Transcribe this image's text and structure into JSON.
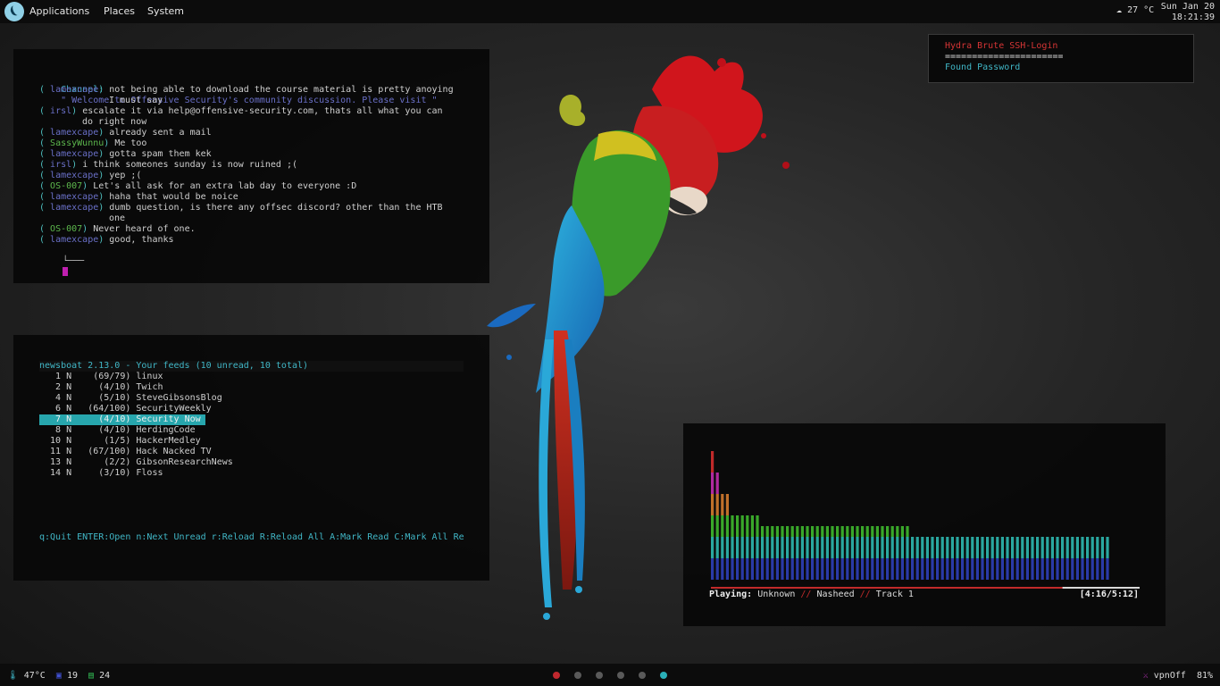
{
  "top_panel": {
    "menus": [
      "Applications",
      "Places",
      "System"
    ],
    "weather": "27 °C",
    "date": "Sun Jan 20",
    "time": "18:21:39"
  },
  "irc": {
    "channel_label": "Channel:",
    "channel_topic": "\" Welcome to Offensive Security's community discussion. Please visit \"",
    "lines": [
      {
        "nick": "lamexcape",
        "text": "not being able to download the course material is pretty anoying",
        "cont": "I must say"
      },
      {
        "nick": "irsl",
        "text": "escalate it via help@offensive-security.com, thats all what you can",
        "cont": "do right now"
      },
      {
        "nick": "lamexcape",
        "text": "already sent a mail",
        "cont": ""
      },
      {
        "nick": "SassyWunnu",
        "text": "Me too",
        "cont": ""
      },
      {
        "nick": "lamexcape",
        "text": "gotta spam them kek",
        "cont": ""
      },
      {
        "nick": "irsl",
        "text": "i think someones sunday is now ruined ;(",
        "cont": ""
      },
      {
        "nick": "lamexcape",
        "text": "yep ;(",
        "cont": ""
      },
      {
        "nick": "OS-007",
        "text": "Let's all ask for an extra lab day to everyone :D",
        "cont": ""
      },
      {
        "nick": "lamexcape",
        "text": "haha that would be noice",
        "cont": ""
      },
      {
        "nick": "lamexcape",
        "text": "dumb question, is there any offsec discord? other than the HTB",
        "cont": "one"
      },
      {
        "nick": "OS-007",
        "text": "Never heard of one.",
        "cont": ""
      },
      {
        "nick": "lamexcape",
        "text": "good, thanks",
        "cont": ""
      }
    ],
    "prompt": "└───"
  },
  "newsboat": {
    "title": "newsboat 2.13.0 - Your feeds (10 unread, 10 total)",
    "feeds": [
      {
        "num": "1",
        "flag": "N",
        "count": "(69/79)",
        "name": "linux"
      },
      {
        "num": "2",
        "flag": "N",
        "count": "(4/10)",
        "name": "Twich"
      },
      {
        "num": "4",
        "flag": "N",
        "count": "(5/10)",
        "name": "SteveGibsonsBlog"
      },
      {
        "num": "6",
        "flag": "N",
        "count": "(64/100)",
        "name": "SecurityWeekly"
      },
      {
        "num": "7",
        "flag": "N",
        "count": "(4/10)",
        "name": "Security Now"
      },
      {
        "num": "8",
        "flag": "N",
        "count": "(4/10)",
        "name": "HerdingCode"
      },
      {
        "num": "10",
        "flag": "N",
        "count": "(1/5)",
        "name": "HackerMedley"
      },
      {
        "num": "11",
        "flag": "N",
        "count": "(67/100)",
        "name": "Hack Nacked TV"
      },
      {
        "num": "13",
        "flag": "N",
        "count": "(2/2)",
        "name": "GibsonResearchNews"
      },
      {
        "num": "14",
        "flag": "N",
        "count": "(3/10)",
        "name": "Floss"
      }
    ],
    "selected_index": 4,
    "help": "q:Quit ENTER:Open n:Next Unread r:Reload R:Reload All A:Mark Read C:Mark All Re"
  },
  "hydra": {
    "title": "Hydra Brute SSH-Login",
    "separator": "======================",
    "found": "Found Password"
  },
  "visualizer": {
    "playing_label": "Playing:",
    "artist": "Unknown",
    "sep1": "//",
    "album": "Nasheed",
    "sep2": "//",
    "track": "Track 1",
    "time": "[4:16/5:12]",
    "progress": 0.82,
    "bar_levels": [
      12,
      10,
      8,
      8,
      6,
      6,
      6,
      6,
      6,
      6,
      5,
      5,
      5,
      5,
      5,
      5,
      5,
      5,
      5,
      5,
      5,
      5,
      5,
      5,
      5,
      5,
      5,
      5,
      5,
      5,
      5,
      5,
      5,
      5,
      5,
      5,
      5,
      5,
      5,
      5,
      4,
      4,
      4,
      4,
      4,
      4,
      4,
      4,
      4,
      4,
      4,
      4,
      4,
      4,
      4,
      4,
      4,
      4,
      4,
      4,
      4,
      4,
      4,
      4,
      4,
      4,
      4,
      4,
      4,
      4,
      4,
      4,
      4,
      4,
      4,
      4,
      4,
      4,
      4,
      4
    ],
    "colors": [
      "#2a3aa8",
      "#2aa8a0",
      "#3aa82a",
      "#c0702a",
      "#b02aa0",
      "#c02a2a"
    ]
  },
  "bottom_panel": {
    "cpu_temp": "47°C",
    "ws_count_a": "19",
    "ws_count_b": "24",
    "vpn": "vpnOff",
    "battery": "81%",
    "workspace_colors": [
      "#c0282e",
      "#5a5a5a",
      "#5a5a5a",
      "#5a5a5a",
      "#5a5a5a",
      "#2ab0b8"
    ]
  }
}
